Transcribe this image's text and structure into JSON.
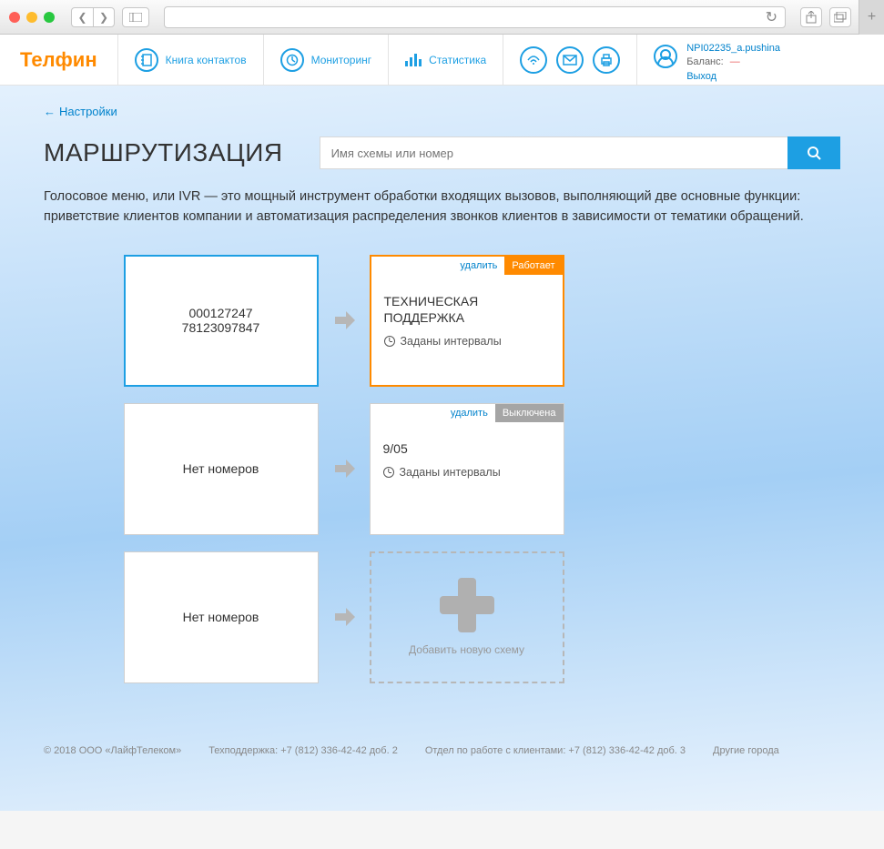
{
  "nav": {
    "logo": "Телфин",
    "contacts": "Книга контактов",
    "monitoring": "Мониторинг",
    "stats": "Статистика"
  },
  "user": {
    "login": "NPI02235_a.pushina",
    "balance_label": "Баланс:",
    "balance_value": "—",
    "logout": "Выход"
  },
  "back_link": "Настройки",
  "page_title": "МАРШРУТИЗАЦИЯ",
  "search_placeholder": "Имя схемы или номер",
  "description": "Голосовое меню, или IVR — это мощный инструмент обработки входящих вызовов, выполняющий две основные функции: приветствие клиентов компании и автоматизация распределения звонков клиентов в зависимости от тематики обращений.",
  "labels": {
    "delete": "удалить",
    "status_on": "Работает",
    "status_off": "Выключена",
    "intervals": "Заданы интервалы",
    "no_numbers": "Нет номеров",
    "add_scheme": "Добавить новую схему"
  },
  "rows": [
    {
      "numbers": [
        "000127247",
        "78123097847"
      ],
      "scheme_title": "ТЕХНИЧЕСКАЯ ПОДДЕРЖКА",
      "status": "on"
    },
    {
      "numbers": [],
      "scheme_title": "9/05",
      "status": "off"
    },
    {
      "numbers": [],
      "scheme_title": null,
      "status": null
    }
  ],
  "footer": {
    "copyright": "© 2018 ООО «ЛайфТелеком»",
    "support": "Техподдержка: +7 (812) 336-42-42 доб. 2",
    "clients": "Отдел по работе с клиентами: +7 (812) 336-42-42 доб. 3",
    "cities": "Другие города"
  }
}
